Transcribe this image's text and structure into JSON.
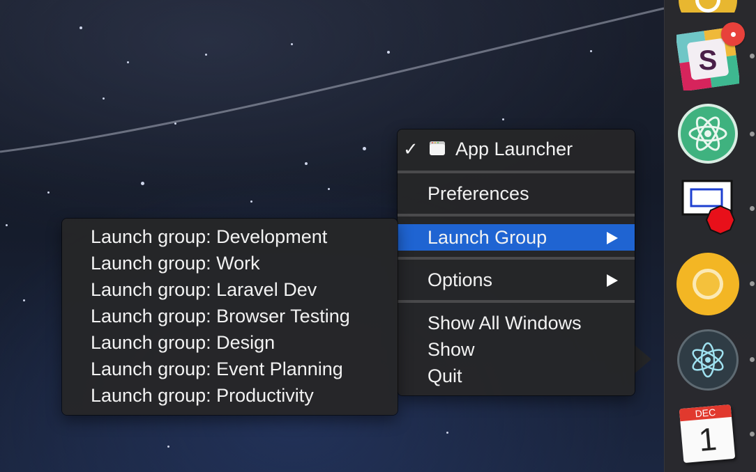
{
  "menu": {
    "items": [
      {
        "label": "App Launcher"
      },
      {
        "label": "Preferences"
      },
      {
        "label": "Launch Group"
      },
      {
        "label": "Options"
      },
      {
        "label": "Show All Windows"
      },
      {
        "label": "Show"
      },
      {
        "label": "Quit"
      }
    ],
    "checkmark": "✓"
  },
  "submenu": {
    "items": [
      {
        "label": "Launch group: Development"
      },
      {
        "label": "Launch group: Work"
      },
      {
        "label": "Launch group: Laravel Dev"
      },
      {
        "label": "Launch group: Browser Testing"
      },
      {
        "label": "Launch group: Design"
      },
      {
        "label": "Launch group: Event Planning"
      },
      {
        "label": "Launch group: Productivity"
      }
    ]
  },
  "dock": {
    "icons": [
      "chrome-canary-icon",
      "slack-icon",
      "atom-icon",
      "app-launcher-icon",
      "chrome-icon",
      "electron-icon",
      "calendar-icon"
    ],
    "slack_letter": "S",
    "calendar_month": "DEC",
    "calendar_day": "1",
    "highlight_color": "#1f64d2"
  }
}
